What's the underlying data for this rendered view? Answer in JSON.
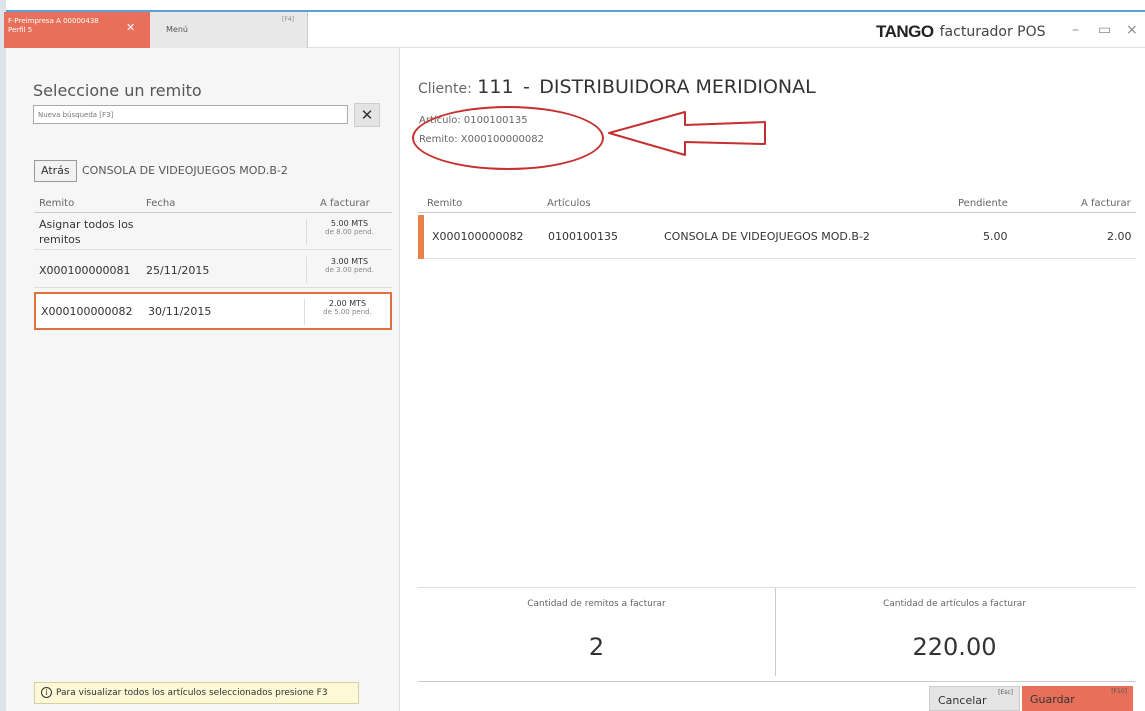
{
  "tabs": {
    "active_line1": "F-Preimpresa A 00000438",
    "active_line2": "Perfil 5",
    "menu_label": "Menú",
    "menu_key": "[F4]"
  },
  "brand": {
    "logo": "TANGO",
    "product": "facturador POS"
  },
  "window_controls": {
    "minimize": "–",
    "maximize": "▭",
    "close": "×"
  },
  "left": {
    "title": "Seleccione un remito",
    "search_placeholder": "Nueva búsqueda [F3]",
    "back_label": "Atrás",
    "breadcrumb": "CONSOLA DE VIDEOJUEGOS MOD.B-2",
    "columns": [
      "Remito",
      "Fecha",
      "A facturar"
    ],
    "rows": [
      {
        "remito": "Asignar todos los remitos",
        "fecha": "",
        "amount": "5.00 MTS",
        "pending": "de 8.00 pend."
      },
      {
        "remito": "X000100000081",
        "fecha": "25/11/2015",
        "amount": "3.00 MTS",
        "pending": "de 3.00 pend."
      },
      {
        "remito": "X000100000082",
        "fecha": "30/11/2015",
        "amount": "2.00 MTS",
        "pending": "de 5.00 pend."
      }
    ],
    "footer_note": "Para visualizar todos los artículos seleccionados presione F3"
  },
  "right": {
    "cliente_label": "Cliente:",
    "cliente_code": "111",
    "cliente_sep": "-",
    "cliente_name": "DISTRIBUIDORA MERIDIONAL",
    "articulo_line": "Artículo: 0100100135",
    "remito_line": "Remito:  X000100000082",
    "columns": [
      "Remito",
      "Artículos",
      "Pendiente",
      "A facturar"
    ],
    "row": {
      "remito": "X000100000082",
      "articulo": "0100100135",
      "descripcion": "CONSOLA DE VIDEOJUEGOS MOD.B-2",
      "pendiente": "5.00",
      "a_facturar": "2.00"
    },
    "totals": {
      "remitos_label": "Cantidad de remitos a facturar",
      "remitos_value": "2",
      "articulos_label": "Cantidad de artículos a facturar",
      "articulos_value": "220.00"
    },
    "buttons": {
      "cancel": "Cancelar",
      "cancel_key": "[Esc]",
      "save": "Guardar",
      "save_key": "[F10]"
    }
  },
  "colors": {
    "accent": "#e8705a",
    "highlight_border": "#e0703f",
    "annotation": "#c62f2f"
  }
}
